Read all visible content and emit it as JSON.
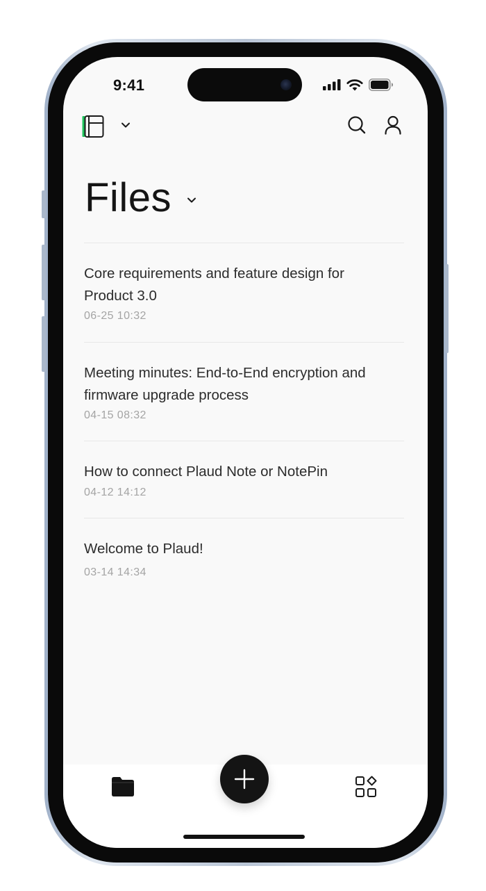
{
  "status_bar": {
    "time": "9:41"
  },
  "header": {
    "icons": [
      "notebook-icon",
      "chevron-down-icon",
      "search-icon",
      "profile-icon"
    ]
  },
  "page": {
    "title": "Files"
  },
  "files": [
    {
      "title": "Core requirements and feature design for Product 3.0",
      "date": "06-25 10:32"
    },
    {
      "title": "Meeting minutes: End-to-End encryption and firmware upgrade process",
      "date": "04-15 08:32"
    },
    {
      "title": "How to connect Plaud Note or NotePin",
      "date": "04-12 14:12"
    },
    {
      "title": "Welcome to Plaud!",
      "date": "03-14 14:34"
    }
  ],
  "tab_bar": {
    "icons": [
      "folder-icon",
      "sparkle-icon",
      "apps-icon"
    ]
  },
  "colors": {
    "accent": "#22c55e",
    "screen_bg": "#f9f9f9",
    "text_primary": "#2c2c2c",
    "text_secondary": "#a4a4a4",
    "fab": "#141414"
  }
}
